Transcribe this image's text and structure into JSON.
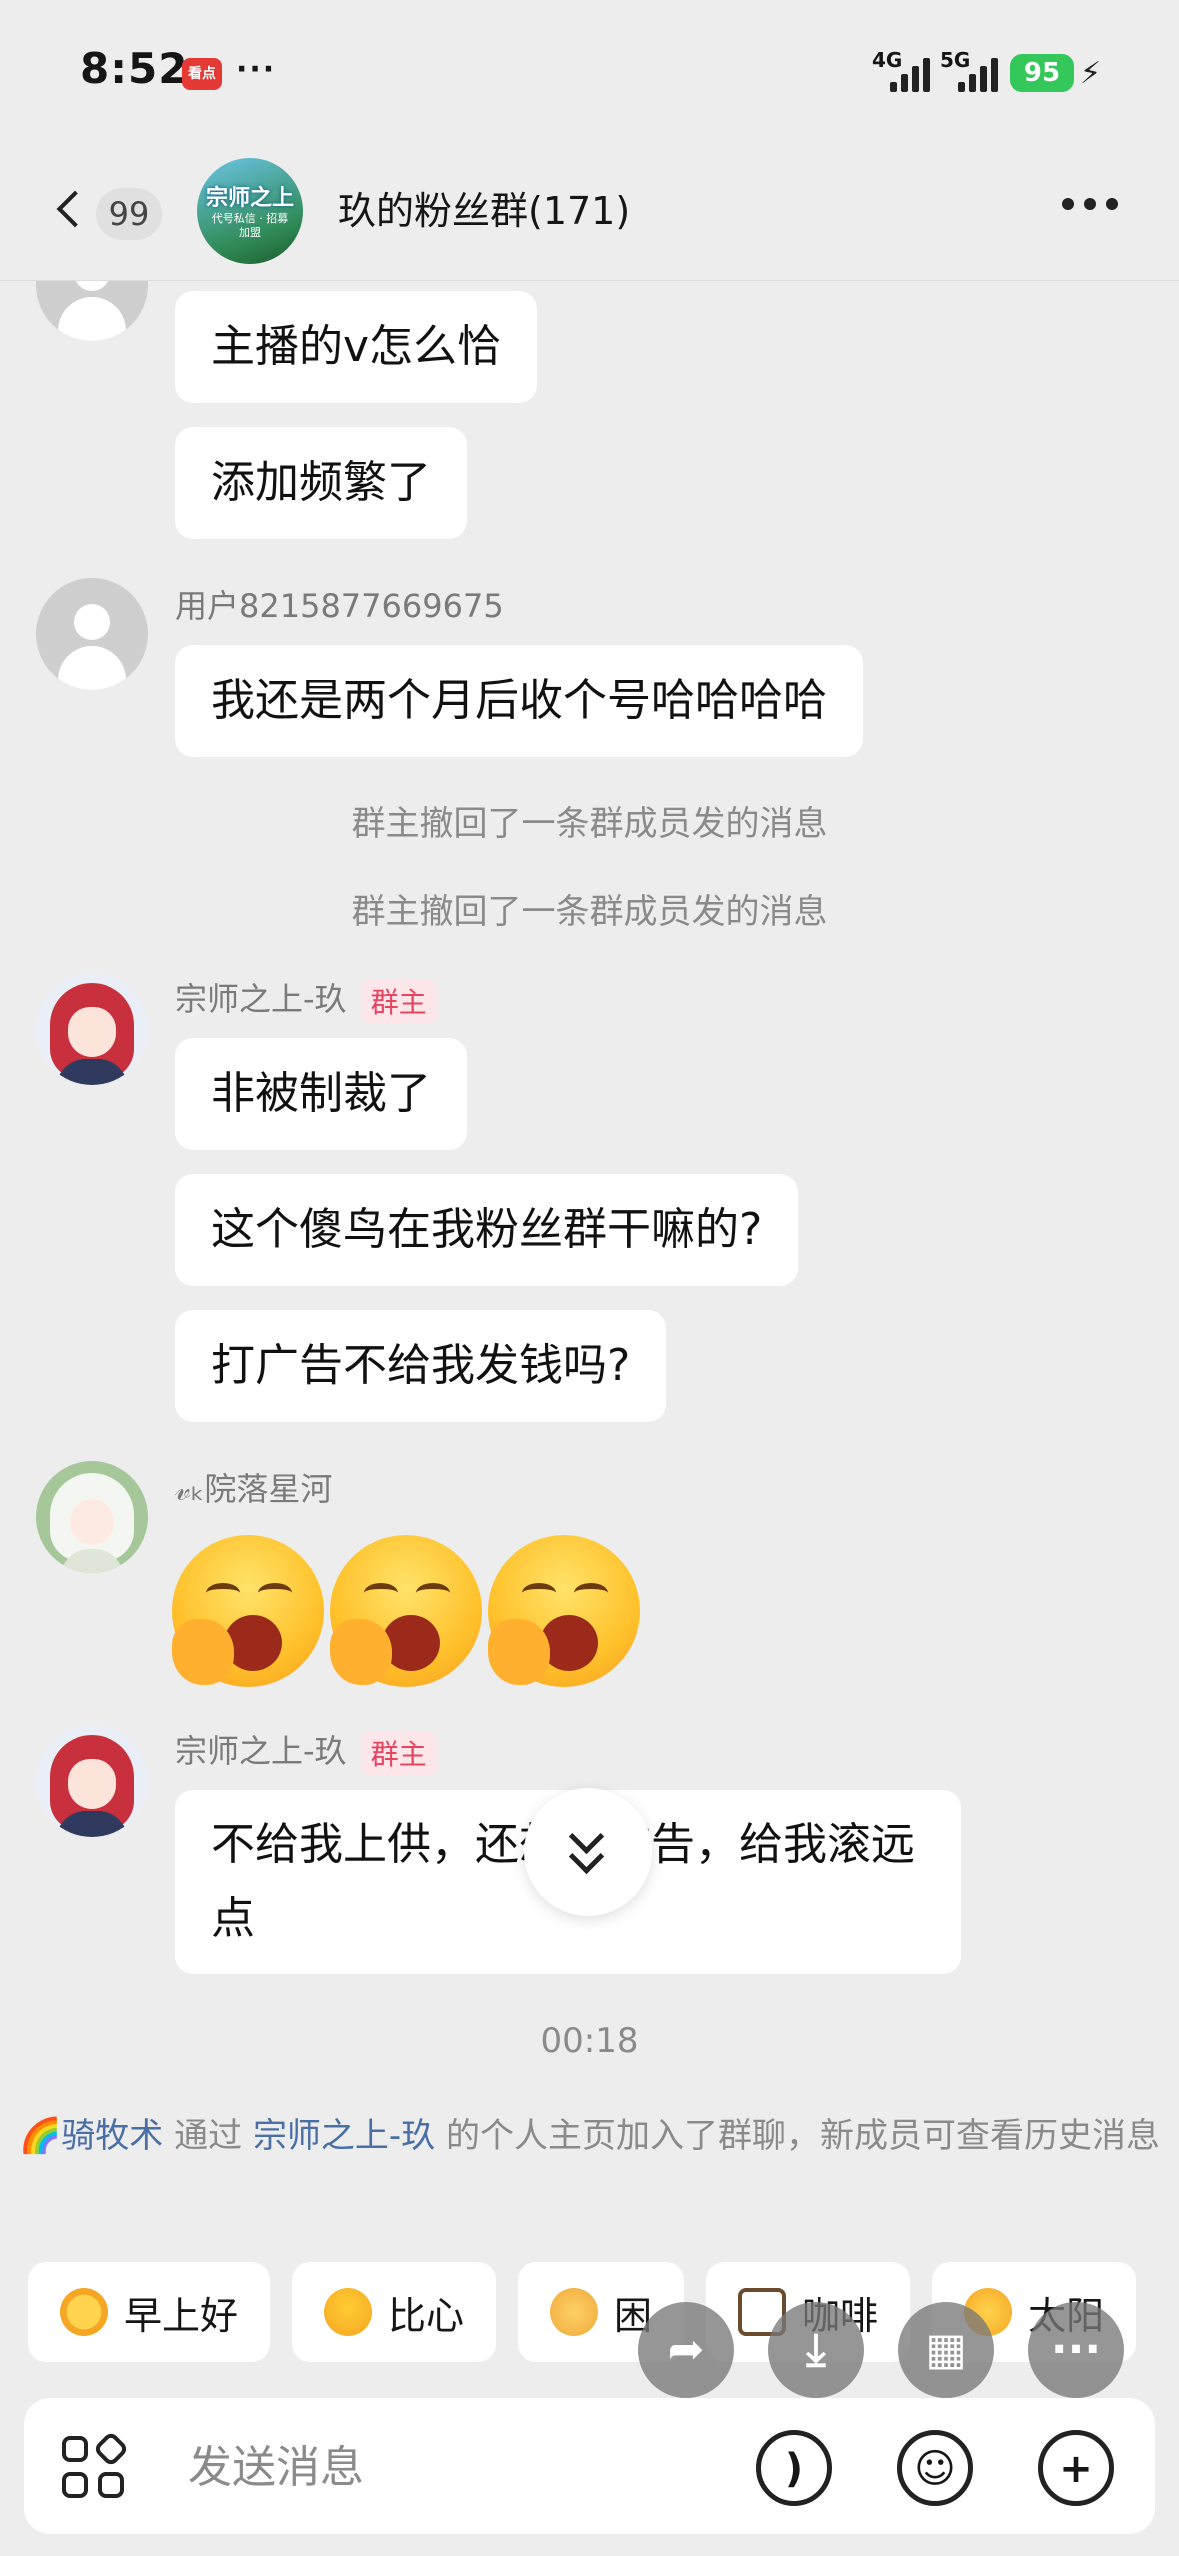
{
  "status_bar": {
    "time": "8:52",
    "app_badge": "看点",
    "dots": "···",
    "network_1": "4G",
    "network_2": "5G",
    "battery": "95"
  },
  "header": {
    "back_count": "99",
    "title": "玖的粉丝群(171)",
    "group_avatar_title": "宗师之上",
    "group_avatar_sub": "代号私信 · 招募加盟"
  },
  "messages": {
    "m1": "主播的v怎么恰",
    "m2": "添加频繁了",
    "u2_name": "用户8215877669675",
    "m3": "我还是两个月后收个号哈哈哈哈",
    "sys1": "群主撤回了一条群成员发的消息",
    "sys2": "群主撤回了一条群成员发的消息",
    "owner_name": "宗师之上-玖",
    "owner_badge": "群主",
    "m4": "非被制裁了",
    "m5": "这个傻鸟在我粉丝群干嘛的?",
    "m6": "打广告不给我发钱吗?",
    "u3_name": "𝓋ₖ院落星河",
    "owner_name_2": "宗师之上-玖",
    "owner_badge_2": "群主",
    "m7": "不给我上供，还想打广告，给我滚远点",
    "time_label": "00:18",
    "join_name": "🌈骑牧术",
    "join_via": " 通过 ",
    "join_host": "宗师之上-玖",
    "join_rest": " 的个人主页加入了群聊，新成员可查看历史消息"
  },
  "quick_replies": [
    "早上好",
    "比心",
    "困",
    "咖啡",
    "太阳"
  ],
  "input": {
    "placeholder": "发送消息"
  },
  "icons": {
    "fab_1": "share-icon",
    "fab_2": "download-icon",
    "fab_3": "grid-icon",
    "fab_4": "more-icon"
  }
}
